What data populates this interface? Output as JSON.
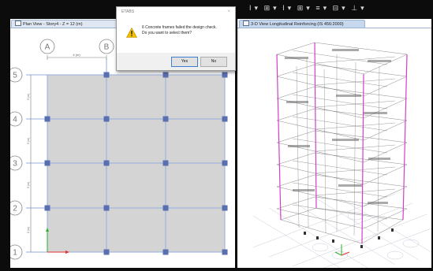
{
  "toolbar": {
    "glyphs": [
      "I",
      "▾",
      "⊞",
      "▾",
      "I",
      "▾",
      "⊞",
      "▾",
      "≡",
      "▾",
      "⊟",
      "▾",
      "⊥",
      "▾"
    ]
  },
  "left_view": {
    "tab_title": "Plan View - Story4 - Z = 12 (m)",
    "column_bubbles": [
      "A",
      "B"
    ],
    "row_bubbles": [
      "5",
      "4",
      "3",
      "2",
      "1"
    ],
    "dimension_label": "4 (m)",
    "spacing_labels": [
      "3 (m)",
      "3 (m)",
      "3 (m)",
      "3 (m)"
    ]
  },
  "right_view": {
    "tab_title": "3-D View  Longitudinal Reinforcing  (IS 456:2000)"
  },
  "dialog": {
    "title": "ETABS",
    "close_glyph": "×",
    "message_line1": "6 Concrete frames failed the design check.",
    "message_line2": "Do you want to select them?",
    "yes_label": "Yes",
    "no_label": "No"
  },
  "colors": {
    "slab": "#d4d4d4",
    "grid_line": "#96aedc",
    "column": "#5a6fb0",
    "frame_pink": "#d040c8",
    "axis_x": "#e03030",
    "axis_y": "#2ab02a",
    "warning": "#f2c000"
  }
}
